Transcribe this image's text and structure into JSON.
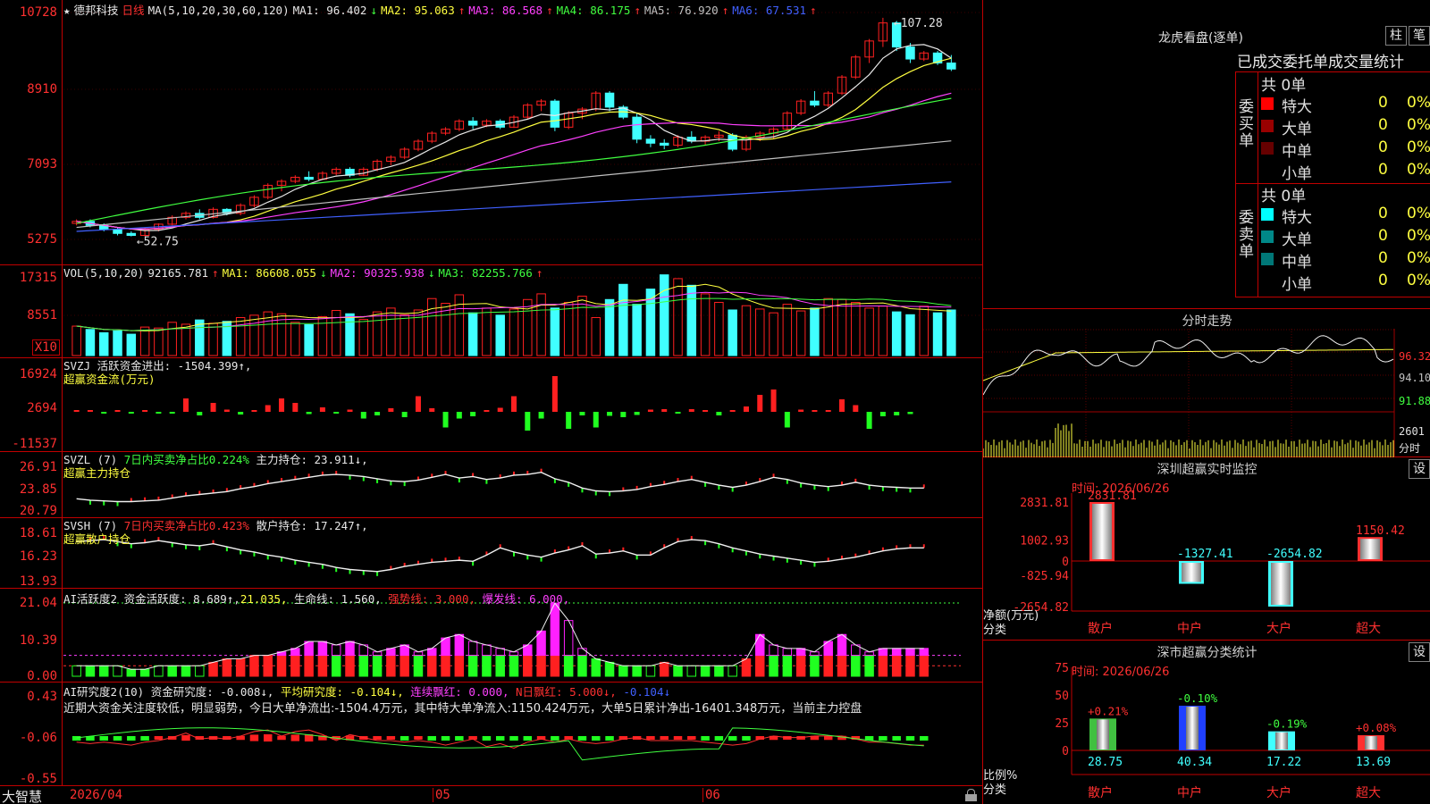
{
  "stock": {
    "name": "德邦科技",
    "period": "日线",
    "star": "★",
    "logo": "大智慧"
  },
  "colors": {
    "up": "#ff2020",
    "down": "#40ffff",
    "bg": "#000000",
    "grid": "#c00000"
  },
  "kline": {
    "ma_label": "MA(5,10,20,30,60,120)",
    "ma": [
      {
        "label": "MA1:",
        "value": "96.402",
        "arrow": "↓",
        "color": "#e8e8e8"
      },
      {
        "label": "MA2:",
        "value": "95.063",
        "arrow": "↑",
        "color": "#ffff40"
      },
      {
        "label": "MA3:",
        "value": "86.568",
        "arrow": "↑",
        "color": "#ff40ff"
      },
      {
        "label": "MA4:",
        "value": "86.175",
        "arrow": "↑",
        "color": "#40ff40"
      },
      {
        "label": "MA5:",
        "value": "76.920",
        "arrow": "↑",
        "color": "#c0c0c0"
      },
      {
        "label": "MA6:",
        "value": "67.531",
        "arrow": "↑",
        "color": "#4060ff"
      }
    ],
    "yticks": [
      "10728",
      "8910",
      "7093",
      "5275"
    ],
    "high_note": "107.28",
    "low_note": "52.75"
  },
  "vol": {
    "label": "VOL(5,10,20)",
    "value": "92165.781",
    "value_arrow": "↑",
    "ma": [
      {
        "label": "MA1:",
        "value": "86608.055",
        "arrow": "↓",
        "color": "#ffff40"
      },
      {
        "label": "MA2:",
        "value": "90325.938",
        "arrow": "↓",
        "color": "#ff40ff"
      },
      {
        "label": "MA3:",
        "value": "82255.766",
        "arrow": "↑",
        "color": "#40ff40"
      }
    ],
    "yticks": [
      "17315",
      "8551"
    ],
    "unit": "X10"
  },
  "svzj": {
    "line1": "SVZJ  活跃资金进出: -1504.399↑,",
    "line2": "超赢资金流(万元)",
    "yticks": [
      "16924",
      "2694",
      "-11537"
    ]
  },
  "svzl": {
    "parts": [
      {
        "text": "SVZL (7) ",
        "color": "#e8e8e8"
      },
      {
        "text": "7日内买卖净占比0.224%",
        "color": "#40ff40"
      },
      {
        "text": " 主力持仓: 23.911↓,",
        "color": "#e8e8e8"
      }
    ],
    "line2": "超赢主力持仓",
    "yticks": [
      "26.91",
      "23.85",
      "20.79"
    ]
  },
  "svsh": {
    "parts": [
      {
        "text": "SVSH (7) ",
        "color": "#e8e8e8"
      },
      {
        "text": "7日内买卖净占比0.423%",
        "color": "#ff3030"
      },
      {
        "text": " 散户持仓: 17.247↑,",
        "color": "#e8e8e8"
      }
    ],
    "line2": "超赢散户持仓",
    "yticks": [
      "18.61",
      "16.23",
      "13.93"
    ]
  },
  "ai_active": {
    "parts": [
      {
        "text": "AI活跃度2 资金活跃度: 8.689↑,",
        "color": "#e8e8e8"
      },
      {
        "text": "21.035,",
        "color": "#ffff40"
      },
      {
        "text": " 生命线: 1.560,",
        "color": "#e8e8e8"
      },
      {
        "text": " 强势线: 3.000,",
        "color": "#ff3030"
      },
      {
        "text": " 爆发线: 6.000,",
        "color": "#ff40ff"
      }
    ],
    "yticks": [
      "21.04",
      "10.39",
      "0.00"
    ]
  },
  "ai_research": {
    "parts": [
      {
        "text": "AI研究度2(10) 资金研究度: -0.008↓,",
        "color": "#e8e8e8"
      },
      {
        "text": " 平均研究度: -0.104↓,",
        "color": "#ffff40"
      },
      {
        "text": " 连续飘红: 0.000,",
        "color": "#ff40ff"
      },
      {
        "text": " N日飘红: 5.000↓,",
        "color": "#ff3030"
      },
      {
        "text": " -0.104↓",
        "color": "#4060ff"
      }
    ],
    "comment": "近期大资金关注度较低，明显弱势，今日大单净流出:-1504.4万元，其中特大单净流入:1150.424万元，大单5日累计净出-16401.348万元，当前主力控盘",
    "yticks": [
      "0.43",
      "-0.06",
      "-0.55"
    ]
  },
  "xaxis": {
    "labels": [
      "2026/04",
      "05",
      "06"
    ]
  },
  "dragon": {
    "title": "龙虎看盘(逐单)",
    "btn1": "柱",
    "btn2": "笔",
    "subtitle": "已成交委托单成交量统计",
    "buy": {
      "label": "委买单",
      "total": "共 0单",
      "rows": [
        {
          "name": "特大",
          "count": "0",
          "pct": "0%",
          "color": "#ff0000"
        },
        {
          "name": "大单",
          "count": "0",
          "pct": "0%",
          "color": "#990000"
        },
        {
          "name": "中单",
          "count": "0",
          "pct": "0%",
          "color": "#660000"
        },
        {
          "name": "小单",
          "count": "0",
          "pct": "0%",
          "color": ""
        }
      ]
    },
    "sell": {
      "label": "委卖单",
      "total": "共 0单",
      "rows": [
        {
          "name": "特大",
          "count": "0",
          "pct": "0%",
          "color": "#00ffff"
        },
        {
          "name": "大单",
          "count": "0",
          "pct": "0%",
          "color": "#008888"
        },
        {
          "name": "中单",
          "count": "0",
          "pct": "0%",
          "color": "#007777"
        },
        {
          "name": "小单",
          "count": "0",
          "pct": "0%",
          "color": ""
        }
      ]
    }
  },
  "intraday": {
    "title": "分时走势",
    "yticks": [
      "96.32",
      "94.10",
      "91.88"
    ],
    "vol_label": "2601",
    "vol_unit": "分时"
  },
  "monitor": {
    "title": "深圳超赢实时监控",
    "btn": "设",
    "time": "时间: 2026/06/26",
    "yticks": [
      "2831.81",
      "1002.93",
      "0",
      "-825.94",
      "-2654.82"
    ],
    "ylab1": "净额(万元)",
    "ylab2": "分类",
    "bars": [
      {
        "cat": "散户",
        "value": 2831.81,
        "label": "2831.81",
        "color": "#ff3030"
      },
      {
        "cat": "中户",
        "value": -1327.41,
        "label": "-1327.41",
        "color": "#40ffff"
      },
      {
        "cat": "大户",
        "value": -2654.82,
        "label": "-2654.82",
        "color": "#40ffff"
      },
      {
        "cat": "超大",
        "value": 1150.42,
        "label": "1150.42",
        "color": "#ff3030"
      }
    ]
  },
  "classify": {
    "title": "深市超赢分类统计",
    "btn": "设",
    "time": "时间: 2026/06/26",
    "yticks": [
      "75",
      "50",
      "25",
      "0"
    ],
    "ylab1": "比例%",
    "ylab2": "分类",
    "bars": [
      {
        "cat": "散户",
        "value": 28.75,
        "label": "28.75",
        "delta": "+0.21%",
        "fill": "#40c040",
        "dcolor": "#ff3030"
      },
      {
        "cat": "中户",
        "value": 40.34,
        "label": "40.34",
        "delta": "-0.10%",
        "fill": "#2040ff",
        "dcolor": "#40ff40"
      },
      {
        "cat": "大户",
        "value": 17.22,
        "label": "17.22",
        "delta": "-0.19%",
        "fill": "#40ffff",
        "dcolor": "#40ff40"
      },
      {
        "cat": "超大",
        "value": 13.69,
        "label": "13.69",
        "delta": "+0.08%",
        "fill": "#ff3030",
        "dcolor": "#ff3030"
      }
    ]
  },
  "chart_data": {
    "type": "candlestick",
    "title": "德邦科技 日线",
    "x": [
      "2026/04",
      "05",
      "06"
    ],
    "ylim": [
      52.75,
      107.28
    ],
    "ohlc": [
      [
        56,
        57,
        55.5,
        56.5
      ],
      [
        56.5,
        57,
        55,
        55.5
      ],
      [
        55.5,
        56,
        54,
        54.5
      ],
      [
        54.5,
        55,
        53,
        53.5
      ],
      [
        53.5,
        54,
        52.75,
        53
      ],
      [
        53,
        55,
        52.8,
        54.5
      ],
      [
        54.5,
        56,
        54,
        55.8
      ],
      [
        55.8,
        58,
        55.5,
        57.5
      ],
      [
        57.5,
        59,
        57,
        58.5
      ],
      [
        58.5,
        59.5,
        57,
        57.5
      ],
      [
        57.5,
        60,
        57.2,
        59.5
      ],
      [
        59.5,
        59.8,
        58,
        58.5
      ],
      [
        58.5,
        61,
        58,
        60.5
      ],
      [
        60.5,
        63,
        60,
        62.5
      ],
      [
        62.5,
        66,
        62,
        65.5
      ],
      [
        65.5,
        67,
        64,
        66.5
      ],
      [
        66.5,
        68,
        66,
        67.5
      ],
      [
        67.5,
        69,
        66.5,
        67
      ],
      [
        67,
        69,
        66.8,
        68.5
      ],
      [
        68.5,
        70,
        68,
        69.5
      ],
      [
        69.5,
        70,
        67.5,
        68
      ],
      [
        68,
        70,
        67.8,
        69.5
      ],
      [
        69.5,
        72,
        69,
        71.5
      ],
      [
        71.5,
        73,
        70.5,
        72.5
      ],
      [
        72.5,
        75,
        72,
        74.5
      ],
      [
        74.5,
        77,
        74,
        76.5
      ],
      [
        76.5,
        79,
        76,
        78.5
      ],
      [
        78.5,
        80,
        78,
        79.5
      ],
      [
        79.5,
        82,
        79,
        81.5
      ],
      [
        81.5,
        82.5,
        79.5,
        80.5
      ],
      [
        80.5,
        82,
        80,
        81.5
      ],
      [
        81.5,
        82,
        79.5,
        80
      ],
      [
        80,
        83,
        79.8,
        82.5
      ],
      [
        82.5,
        86,
        82,
        85.5
      ],
      [
        85.5,
        87,
        84,
        86.5
      ],
      [
        86.5,
        87,
        79,
        80
      ],
      [
        80,
        84,
        79.5,
        83.5
      ],
      [
        83.5,
        85,
        82,
        84.5
      ],
      [
        84.5,
        89,
        84,
        88.5
      ],
      [
        88.5,
        89,
        84,
        85
      ],
      [
        85,
        85.5,
        82,
        82.5
      ],
      [
        82.5,
        83.5,
        76,
        77
      ],
      [
        77,
        78,
        75,
        76
      ],
      [
        76,
        77,
        74.5,
        75.5
      ],
      [
        75.5,
        78,
        75,
        77.5
      ],
      [
        77.5,
        79,
        76,
        76.5
      ],
      [
        76.5,
        78,
        75.5,
        77.5
      ],
      [
        77.5,
        79,
        76.5,
        78
      ],
      [
        78,
        78.5,
        74,
        74.5
      ],
      [
        74.5,
        78,
        74,
        77.5
      ],
      [
        77.5,
        79,
        76.5,
        78.5
      ],
      [
        78.5,
        80,
        77,
        79.5
      ],
      [
        79.5,
        84,
        79,
        83.5
      ],
      [
        83.5,
        87,
        83,
        86.5
      ],
      [
        86.5,
        89,
        85,
        85.5
      ],
      [
        85.5,
        89,
        85,
        88.5
      ],
      [
        88.5,
        93,
        88,
        92.5
      ],
      [
        92.5,
        98,
        92,
        97.5
      ],
      [
        97.5,
        102,
        96,
        101.5
      ],
      [
        101.5,
        107.28,
        100,
        106
      ],
      [
        106,
        106.5,
        99,
        100
      ],
      [
        100,
        101,
        96,
        97
      ],
      [
        97,
        99,
        96.5,
        98.5
      ],
      [
        98.5,
        99,
        95.5,
        96
      ],
      [
        96,
        98,
        94,
        94.5
      ]
    ],
    "series": [
      {
        "name": "MA1",
        "last": 96.402
      },
      {
        "name": "MA2",
        "last": 95.063
      },
      {
        "name": "MA3",
        "last": 86.568
      },
      {
        "name": "MA4",
        "last": 86.175
      },
      {
        "name": "MA5",
        "last": 76.92
      },
      {
        "name": "MA6",
        "last": 67.531
      }
    ],
    "volume": [
      62,
      55,
      48,
      52,
      45,
      60,
      58,
      70,
      66,
      75,
      68,
      72,
      80,
      85,
      92,
      88,
      70,
      65,
      82,
      95,
      88,
      76,
      92,
      100,
      86,
      96,
      120,
      110,
      128,
      90,
      100,
      85,
      98,
      118,
      130,
      100,
      112,
      125,
      80,
      118,
      150,
      108,
      140,
      170,
      162,
      148,
      130,
      112,
      96,
      105,
      98,
      90,
      108,
      94,
      100,
      120,
      118,
      112,
      100,
      104,
      92,
      86,
      104,
      90,
      96
    ],
    "svzj": [
      200,
      300,
      -150,
      200,
      -300,
      100,
      -200,
      -100,
      3000,
      -800,
      2000,
      500,
      -600,
      300,
      1500,
      3000,
      2000,
      -500,
      1000,
      -200,
      500,
      -1500,
      -800,
      800,
      -1200,
      3500,
      800,
      -3500,
      -1500,
      -1000,
      300,
      900,
      3500,
      -4200,
      -1500,
      8000,
      -3800,
      -800,
      -3500,
      -900,
      -1200,
      -700,
      500,
      600,
      -200,
      600,
      400,
      -800,
      300,
      1200,
      3800,
      5000,
      -3500,
      500,
      400,
      400,
      2800,
      1500,
      -3800,
      -1000,
      -800,
      -500
    ],
    "svzl": [
      22.5,
      22.3,
      22.2,
      22.1,
      22.1,
      22.2,
      22.3,
      22.6,
      22.9,
      23.1,
      23.3,
      23.5,
      23.9,
      24.2,
      24.6,
      24.9,
      25.2,
      25.5,
      25.8,
      25.9,
      25.8,
      25.6,
      25.3,
      25.0,
      24.9,
      25.1,
      25.5,
      25.9,
      25.4,
      25.6,
      25.2,
      25.4,
      25.8,
      25.9,
      26.2,
      25.3,
      24.8,
      24.0,
      23.6,
      23.5,
      23.6,
      23.8,
      24.2,
      24.5,
      24.9,
      25.2,
      24.8,
      24.4,
      24.1,
      24.4,
      24.9,
      25.5,
      25.2,
      24.7,
      24.4,
      24.2,
      24.4,
      24.8,
      24.4,
      24.2,
      24.1,
      24.0,
      24.0
    ],
    "svsh": [
      17.8,
      17.9,
      18.0,
      17.8,
      17.6,
      17.7,
      17.9,
      17.7,
      17.5,
      17.4,
      17.6,
      17.3,
      17.0,
      16.8,
      16.5,
      16.3,
      16.0,
      15.8,
      15.6,
      15.3,
      15.1,
      15.0,
      14.9,
      15.1,
      15.4,
      15.6,
      15.8,
      15.9,
      16.0,
      15.9,
      16.5,
      17.2,
      16.8,
      16.5,
      16.3,
      16.7,
      17.0,
      17.4,
      16.6,
      16.7,
      16.9,
      16.5,
      16.5,
      17.2,
      17.8,
      18.0,
      17.9,
      17.6,
      17.2,
      16.9,
      16.6,
      16.4,
      16.2,
      16.0,
      15.8,
      15.9,
      16.1,
      16.3,
      16.6,
      16.9,
      17.1,
      17.2,
      17.2
    ],
    "ai_active": [
      3,
      3,
      3,
      3,
      2,
      2,
      3,
      3,
      3,
      3,
      4,
      5,
      5,
      6,
      6,
      7,
      8,
      10,
      10,
      9,
      10,
      9,
      7,
      8,
      9,
      7,
      8,
      11,
      12,
      10,
      9,
      8,
      7,
      9,
      13,
      21,
      16,
      8,
      5,
      4,
      3,
      3,
      3,
      4,
      3,
      3,
      3,
      3,
      3,
      5,
      12,
      9,
      8,
      8,
      7,
      10,
      12,
      9,
      7,
      8,
      8,
      8,
      8
    ],
    "ai_research": [
      -0.05,
      -0.06,
      -0.05,
      -0.06,
      -0.07,
      -0.05,
      -0.04,
      -0.02,
      0.01,
      -0.03,
      -0.02,
      -0.03,
      -0.01,
      0.02,
      0.03,
      -0.01,
      0.02,
      0.03,
      0.0,
      -0.04,
      0.0,
      -0.02,
      -0.04,
      -0.04,
      -0.05,
      -0.04,
      -0.05,
      -0.07,
      -0.05,
      -0.03,
      -0.08,
      -0.06,
      -0.09,
      -0.05,
      -0.03,
      -0.05,
      -0.03,
      -0.05,
      -0.06,
      -0.05,
      -0.03,
      -0.02,
      -0.04,
      -0.04,
      -0.04,
      -0.04,
      -0.05,
      -0.06,
      -0.07,
      -0.06,
      -0.03,
      -0.01,
      -0.02,
      -0.02,
      -0.01,
      -0.01,
      -0.01,
      -0.03,
      -0.05,
      -0.05,
      -0.06,
      -0.07,
      -0.07
    ]
  }
}
